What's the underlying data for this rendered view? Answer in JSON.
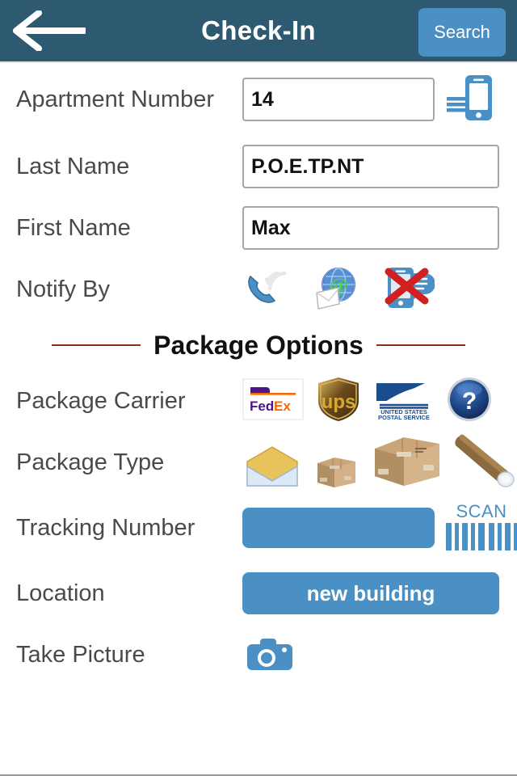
{
  "header": {
    "title": "Check-In",
    "back_icon": "back-arrow-icon",
    "search_label": "Search"
  },
  "form": {
    "apartment": {
      "label": "Apartment Number",
      "value": "14",
      "placeholder": "",
      "directory_icon": "phone-directory-icon"
    },
    "last_name": {
      "label": "Last Name",
      "value": "P.O.E.TP.NT",
      "placeholder": ""
    },
    "first_name": {
      "label": "First Name",
      "value": "Max",
      "placeholder": ""
    },
    "notify_by": {
      "label": "Notify By",
      "options": [
        {
          "name": "phone-call-icon",
          "title": "Phone"
        },
        {
          "name": "email-icon",
          "title": "Email"
        },
        {
          "name": "sms-disabled-icon",
          "title": "Text message disabled"
        }
      ]
    }
  },
  "section": {
    "title": "Package Options",
    "rule_color": "#8c2b1e"
  },
  "package": {
    "carrier": {
      "label": "Package Carrier",
      "options": [
        {
          "name": "fedex-logo-icon",
          "title": "FedEx"
        },
        {
          "name": "ups-logo-icon",
          "title": "UPS"
        },
        {
          "name": "usps-logo-icon",
          "title": "United States Postal Service"
        },
        {
          "name": "unknown-carrier-icon",
          "title": "Other"
        }
      ]
    },
    "type": {
      "label": "Package Type",
      "options": [
        {
          "name": "envelope-icon",
          "title": "Envelope"
        },
        {
          "name": "small-box-icon",
          "title": "Small box"
        },
        {
          "name": "large-box-icon",
          "title": "Large box"
        },
        {
          "name": "tube-icon",
          "title": "Tube"
        }
      ]
    },
    "tracking": {
      "label": "Tracking Number",
      "value": "",
      "placeholder": "",
      "scan_label": "SCAN",
      "scan_icon": "barcode-icon"
    },
    "location": {
      "label": "Location",
      "value": "new building"
    },
    "picture": {
      "label": "Take Picture",
      "icon": "camera-icon"
    }
  },
  "colors": {
    "header_bg": "#2d5a70",
    "accent_blue": "#4a90c4",
    "label_gray": "#4a4a4a",
    "rule_red": "#8c2b1e",
    "fedex_purple": "#4d148c",
    "fedex_orange": "#ff6600",
    "ups_brown": "#4f3415",
    "ups_gold": "#c9a227",
    "usps_blue": "#1a4d8f"
  },
  "usps_logo_text": {
    "line1": "UNITED STATES",
    "line2": "POSTAL SERVICE"
  },
  "ups_logo_text": "ups",
  "fedex_logo_text": {
    "fed": "Fed",
    "ex": "Ex"
  },
  "unknown_glyph": "?"
}
